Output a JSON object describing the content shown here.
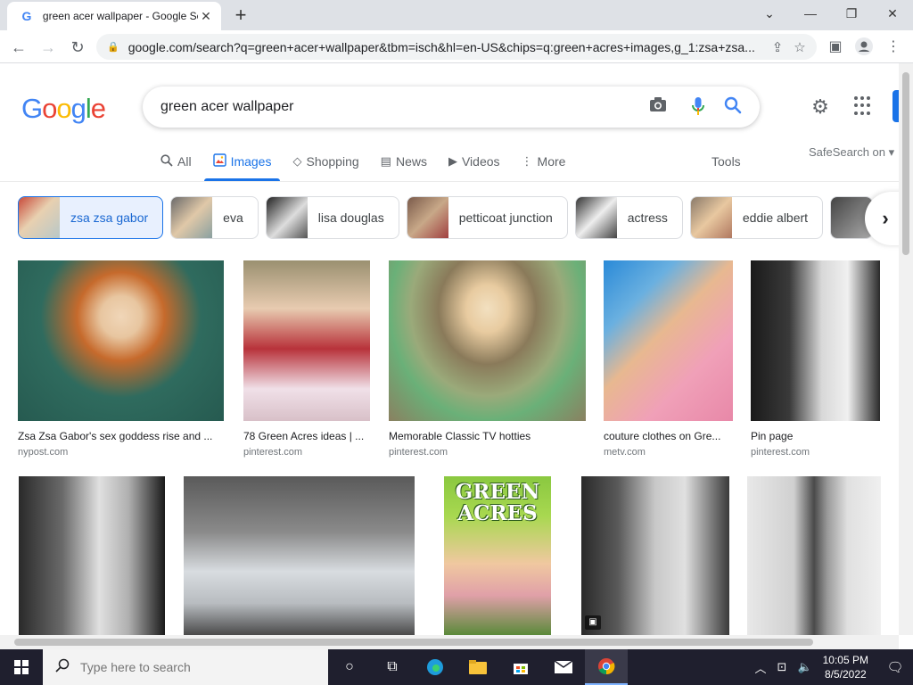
{
  "browser": {
    "tab_title": "green acer wallpaper - Google Se",
    "favicon": "G",
    "url": "google.com/search?q=green+acer+wallpaper&tbm=isch&hl=en-US&chips=q:green+acres+images,g_1:zsa+zsa..."
  },
  "search": {
    "query": "green acer wallpaper"
  },
  "tabs": [
    {
      "label": "All",
      "icon": "search-icon"
    },
    {
      "label": "Images",
      "icon": "image-icon"
    },
    {
      "label": "Shopping",
      "icon": "tag-icon"
    },
    {
      "label": "News",
      "icon": "news-icon"
    },
    {
      "label": "Videos",
      "icon": "play-icon"
    },
    {
      "label": "More",
      "icon": "dots-vertical-icon"
    }
  ],
  "tools_label": "Tools",
  "safesearch_label": "SafeSearch on",
  "chips": [
    {
      "label": "zsa zsa gabor"
    },
    {
      "label": "eva"
    },
    {
      "label": "lisa douglas"
    },
    {
      "label": "petticoat junction"
    },
    {
      "label": "actress"
    },
    {
      "label": "eddie albert"
    }
  ],
  "results_row1": [
    {
      "caption": "Zsa Zsa Gabor's sex goddess rise and ...",
      "source": "nypost.com"
    },
    {
      "caption": "78 Green Acres ideas | ...",
      "source": "pinterest.com"
    },
    {
      "caption": "Memorable Classic TV hotties",
      "source": "pinterest.com"
    },
    {
      "caption": "couture clothes on Gre...",
      "source": "metv.com"
    },
    {
      "caption": "Pin page",
      "source": "pinterest.com"
    }
  ],
  "results_row2_poster_text": "GREEN ACRES",
  "taskbar": {
    "search_placeholder": "Type here to search",
    "time": "10:05 PM",
    "date": "8/5/2022"
  },
  "colors": {
    "accent": "#1a73e8",
    "google_blue": "#4285f4",
    "google_red": "#ea4335",
    "google_yellow": "#fbbc05",
    "google_green": "#34a853"
  }
}
